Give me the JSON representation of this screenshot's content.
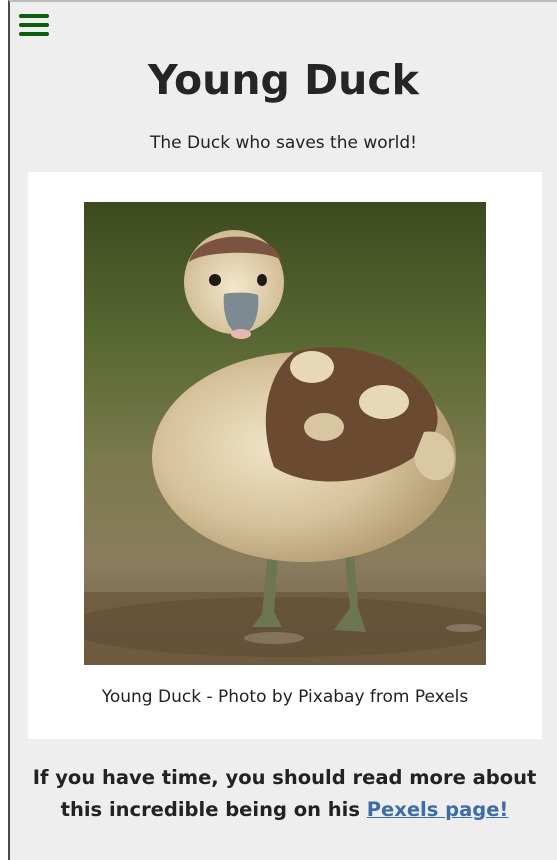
{
  "header": {
    "menu_icon": "hamburger-menu-icon",
    "title": "Young Duck",
    "subtitle": "The Duck who saves the world!"
  },
  "figure": {
    "image_subject": "young duckling standing on ground",
    "caption": "Young Duck - Photo by Pixabay from Pexels"
  },
  "outro": {
    "text": "If you have time, you should read more about this incredible being on his ",
    "link_label": "Pexels page!"
  },
  "colors": {
    "menu_icon": "#0c5d0c",
    "link": "#3a6ea5",
    "background": "#eeeeee",
    "card": "#ffffff"
  }
}
